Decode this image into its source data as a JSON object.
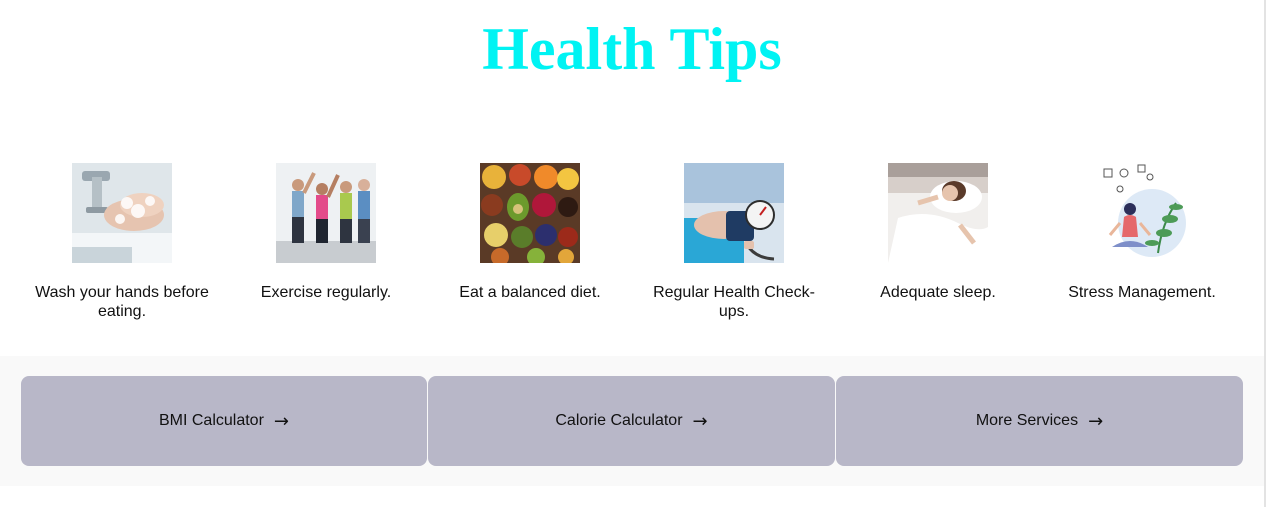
{
  "header": {
    "title": "Health Tips"
  },
  "tips": [
    {
      "label": "Wash your hands before eating.",
      "image": "handwashing-photo"
    },
    {
      "label": "Exercise regularly.",
      "image": "group-exercise-photo"
    },
    {
      "label": "Eat a balanced diet.",
      "image": "healthy-food-photo"
    },
    {
      "label": "Regular Health Check-ups.",
      "image": "blood-pressure-check-photo"
    },
    {
      "label": "Adequate sleep.",
      "image": "sleeping-woman-photo"
    },
    {
      "label": "Stress Management.",
      "image": "meditation-illustration"
    }
  ],
  "services": {
    "bmi_label": "BMI Calculator",
    "calorie_label": "Calorie Calculator",
    "more_label": "More Services",
    "arrow": "→"
  },
  "colors": {
    "title": "#00f3f3",
    "button_bg": "#b8b7c8",
    "band_bg": "#f9f9f9"
  }
}
